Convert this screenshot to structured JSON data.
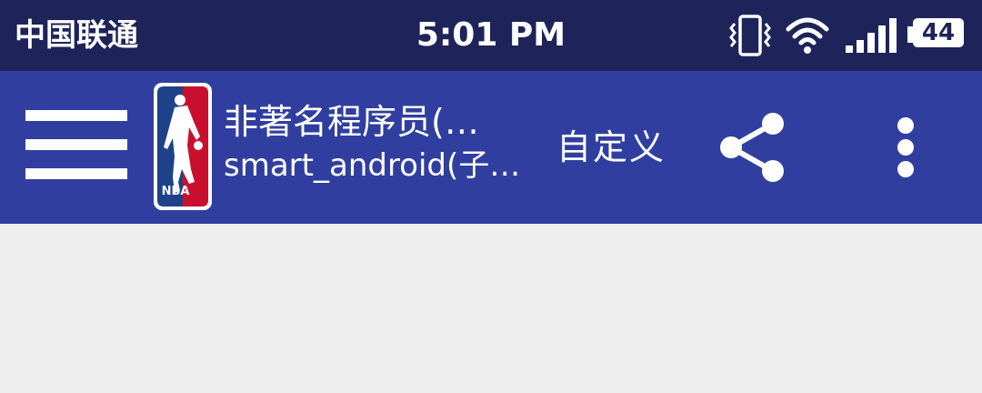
{
  "status_bar": {
    "carrier": "中国联通",
    "time": "5:01 PM",
    "battery_level": "44",
    "icons": [
      "vibrate-icon",
      "wifi-icon",
      "signal-icon",
      "battery-icon"
    ]
  },
  "app_bar": {
    "menu_icon": "menu-icon",
    "logo": "nba-logo",
    "logo_text": "NBA",
    "title": "非著名程序员(…",
    "subtitle": "smart_android(子…",
    "custom_action_label": "自定义",
    "share_icon": "share-icon",
    "overflow_icon": "more-vert-icon"
  },
  "colors": {
    "status_bar_bg": "#1e245a",
    "app_bar_bg": "#303f9f",
    "content_bg": "#eeeeee",
    "foreground": "#ffffff"
  }
}
